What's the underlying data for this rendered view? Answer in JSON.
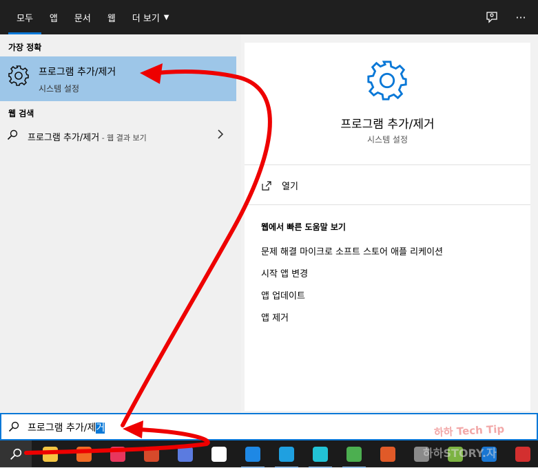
{
  "tabs": [
    {
      "label": "모두",
      "active": true
    },
    {
      "label": "앱",
      "active": false
    },
    {
      "label": "문서",
      "active": false
    },
    {
      "label": "웹",
      "active": false
    },
    {
      "label": "더 보기",
      "active": false
    }
  ],
  "top_icons": [
    "feedback-icon",
    "more-options-icon"
  ],
  "top_more_glyph": "···",
  "left": {
    "best_match_title": "가장 정확",
    "best_match": {
      "title": "프로그램 추가/제거",
      "subtitle": "시스템 설정"
    },
    "web_search_title": "웹 검색",
    "web_result": {
      "text": "프로그램 추가/제거",
      "suffix": " - 웹 결과 보기"
    }
  },
  "right": {
    "title": "프로그램 추가/제거",
    "subtitle": "시스템 설정",
    "open_label": "열기",
    "help_title": "웹에서 빠른 도움말 보기",
    "help_links": [
      "문제 해결 마이크로 소프트 스토어 애플 리케이션",
      "시작 앱 변경",
      "앱 업데이트",
      "앱 제거"
    ]
  },
  "search": {
    "prefix": "프로그램 추가/제",
    "selected": "거"
  },
  "taskbar": {
    "apps": [
      {
        "name": "file-explorer",
        "color": "#f4c542"
      },
      {
        "name": "app-orange",
        "color": "#f06a25"
      },
      {
        "name": "app-pink",
        "color": "#e8365d"
      },
      {
        "name": "app-office",
        "color": "#d64a2b"
      },
      {
        "name": "app-camera",
        "color": "#5b7be0"
      },
      {
        "name": "notepad",
        "color": "#ffffff"
      },
      {
        "name": "app-v",
        "color": "#1e88e5"
      },
      {
        "name": "edge",
        "color": "#1fa0e0"
      },
      {
        "name": "app-bird",
        "color": "#22c3d6"
      },
      {
        "name": "chrome",
        "color": "#4caf50"
      },
      {
        "name": "app-stripes",
        "color": "#e05a28"
      },
      {
        "name": "app-circle",
        "color": "#8a8a8a"
      },
      {
        "name": "app-green",
        "color": "#7cb342"
      },
      {
        "name": "app-blue",
        "color": "#1976d2"
      },
      {
        "name": "filezilla",
        "color": "#d32f2f"
      }
    ]
  },
  "watermark": {
    "line1": "하하 Tech Tip",
    "line2": "하하STORY.자"
  },
  "colors": {
    "accent": "#0a78d7",
    "selection": "#9dc6e8",
    "arrow": "#ee0000"
  }
}
